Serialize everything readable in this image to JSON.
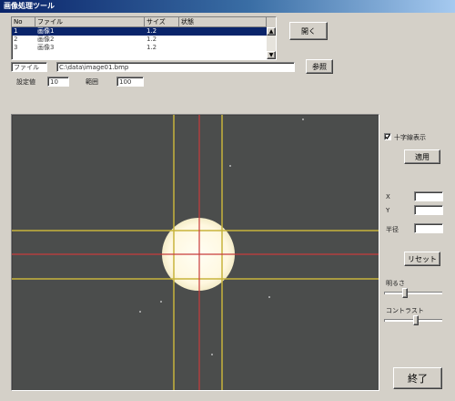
{
  "window": {
    "title": "画像処理ツール"
  },
  "list": {
    "columns": [
      "No",
      "ファイル",
      "サイズ",
      "状態"
    ],
    "rows": [
      {
        "no": "1",
        "name": "画像1",
        "size": "1.2",
        "state": ""
      },
      {
        "no": "2",
        "name": "画像2",
        "size": "1.2",
        "state": ""
      },
      {
        "no": "3",
        "name": "画像3",
        "size": "1.2",
        "state": ""
      }
    ],
    "selected_index": 0
  },
  "toolbar": {
    "open_label": "開く",
    "path_label": "ファイル",
    "path_value": "C:\\data\\image01.bmp",
    "browse_label": "参照",
    "setting1_label": "設定値",
    "setting1_value": "10",
    "setting2_label": "範囲",
    "setting2_value": "100"
  },
  "side_panel": {
    "crosshair_label": "十字線表示",
    "crosshair_checked": true,
    "apply_label": "適用",
    "x_label": "X",
    "y_label": "Y",
    "r_label": "半径",
    "x_value": "",
    "y_value": "",
    "r_value": "",
    "reset_label": "リセット",
    "slider1_label": "明るさ",
    "slider1_level": 0.35,
    "slider2_label": "コントラスト",
    "slider2_level": 0.55,
    "close_label": "終了"
  },
  "colors": {
    "viewer_bg": "#4b4d4c",
    "guide_yellow": "#c8b43c",
    "guide_red": "#c83c3c",
    "spot": "#fffbe8"
  }
}
